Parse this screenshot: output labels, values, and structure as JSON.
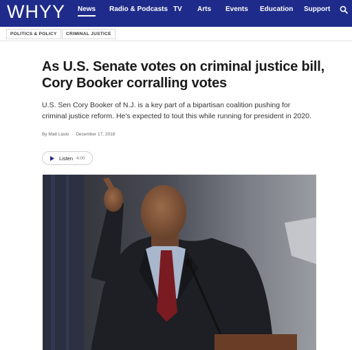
{
  "nav": {
    "logo": "WHYY",
    "items": [
      "News",
      "Radio & Podcasts",
      "TV",
      "Arts",
      "Events",
      "Education",
      "Support"
    ],
    "active": "News",
    "search_icon": "search-icon"
  },
  "categories": [
    "POLITICS & POLICY",
    "CRIMINAL JUSTICE"
  ],
  "article": {
    "headline": "As U.S. Senate votes on criminal justice bill, Cory Booker corralling votes",
    "dek": "U.S. Sen Cory Booker of N.J. is a key part of a bipartisan coalition pushing for criminal justice reform. He's expected to tout this while running for president in 2020.",
    "byline_prefix": "By",
    "author": "Matt Laslo",
    "date": "December 17, 2018",
    "listen_label": "Listen",
    "listen_duration": "4:00"
  },
  "colors": {
    "nav_bg": "#1e2b8a",
    "play_icon": "#1e2b8a"
  }
}
